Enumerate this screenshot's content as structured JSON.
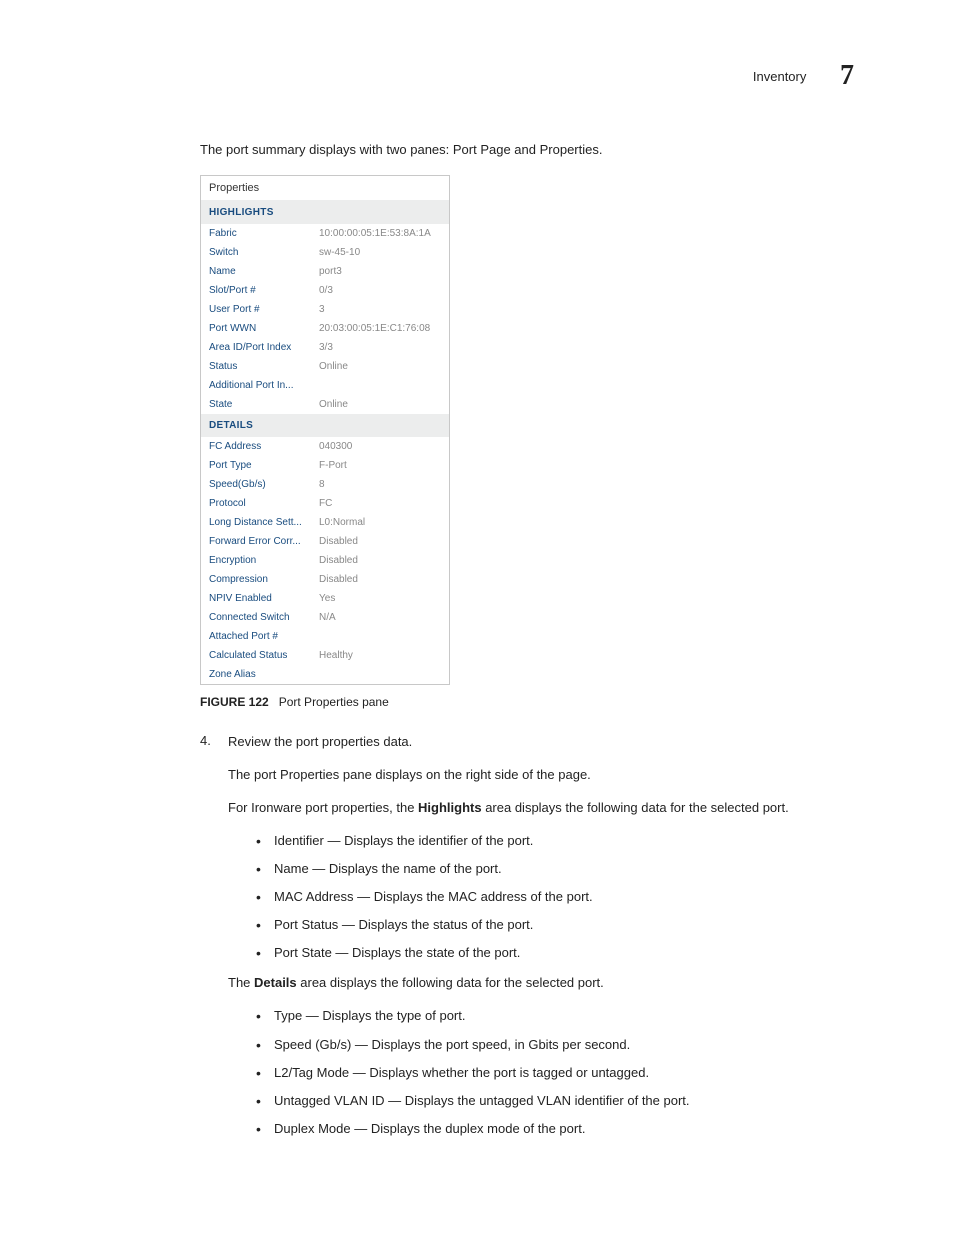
{
  "header": {
    "section": "Inventory",
    "chapter": "7"
  },
  "intro": "The port summary displays with two panes: Port Page and Properties.",
  "panel": {
    "title": "Properties",
    "highlights_header": "HIGHLIGHTS",
    "highlights": [
      {
        "label": "Fabric",
        "value": "10:00:00:05:1E:53:8A:1A"
      },
      {
        "label": "Switch",
        "value": "sw-45-10"
      },
      {
        "label": "Name",
        "value": "port3"
      },
      {
        "label": "Slot/Port #",
        "value": "0/3"
      },
      {
        "label": "User Port #",
        "value": "3"
      },
      {
        "label": "Port WWN",
        "value": "20:03:00:05:1E:C1:76:08"
      },
      {
        "label": "Area ID/Port Index",
        "value": "3/3"
      },
      {
        "label": "Status",
        "value": "Online"
      },
      {
        "label": "Additional Port In...",
        "value": ""
      },
      {
        "label": "State",
        "value": "Online"
      }
    ],
    "details_header": "DETAILS",
    "details": [
      {
        "label": "FC Address",
        "value": "040300"
      },
      {
        "label": "Port Type",
        "value": "F-Port"
      },
      {
        "label": "Speed(Gb/s)",
        "value": "8"
      },
      {
        "label": "Protocol",
        "value": "FC"
      },
      {
        "label": "Long Distance Sett...",
        "value": "L0:Normal"
      },
      {
        "label": "Forward Error Corr...",
        "value": "Disabled"
      },
      {
        "label": "Encryption",
        "value": "Disabled"
      },
      {
        "label": "Compression",
        "value": "Disabled"
      },
      {
        "label": "NPIV Enabled",
        "value": "Yes"
      },
      {
        "label": "Connected Switch",
        "value": "N/A"
      },
      {
        "label": "Attached Port #",
        "value": ""
      },
      {
        "label": "Calculated Status",
        "value": "Healthy"
      },
      {
        "label": "Zone Alias",
        "value": ""
      }
    ]
  },
  "figcaption": {
    "label": "FIGURE 122",
    "text": "Port Properties pane"
  },
  "step": {
    "number": "4.",
    "line1": "Review the port properties data.",
    "line2": "The port Properties pane displays on the right side of the page.",
    "line3_pre": "For Ironware port properties, the ",
    "line3_bold": "Highlights",
    "line3_post": " area displays the following data for the selected port.",
    "highlight_bullets": [
      "Identifier — Displays the identifier of the port.",
      "Name — Displays the name of the port.",
      "MAC Address — Displays the MAC address of the port.",
      "Port Status — Displays the status of the port.",
      "Port State — Displays the state of the port."
    ],
    "line4_pre": "The ",
    "line4_bold": "Details",
    "line4_post": " area displays the following data for the selected port.",
    "detail_bullets": [
      "Type — Displays the type of port.",
      "Speed (Gb/s) — Displays the port speed, in Gbits per second.",
      "L2/Tag Mode — Displays whether the port is tagged or untagged.",
      "Untagged VLAN ID — Displays the untagged VLAN identifier of the port.",
      "Duplex Mode — Displays the duplex mode of the port."
    ]
  }
}
